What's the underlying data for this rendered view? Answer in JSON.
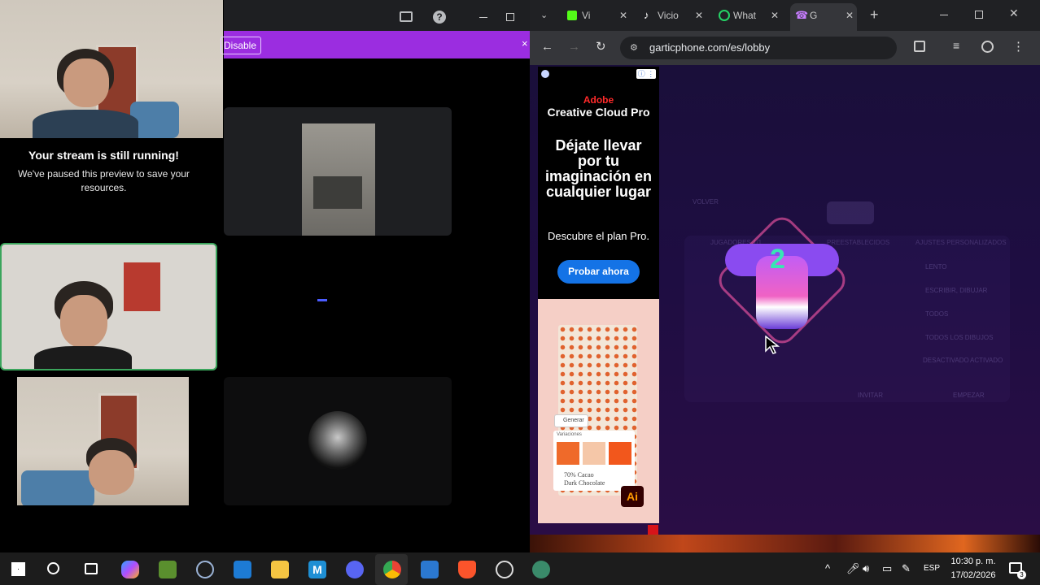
{
  "discord": {
    "stream_paused_title": "Your stream is still running!",
    "stream_paused_message": "We've paused this preview to save your resources.",
    "disable_label": "Disable"
  },
  "browser": {
    "tabs": [
      {
        "label": "Vi",
        "icon": "kick-icon"
      },
      {
        "label": "Vicio",
        "icon": "tiktok-icon"
      },
      {
        "label": "What",
        "icon": "whatsapp-icon"
      },
      {
        "label": "G",
        "icon": "garticphone-icon",
        "active": true
      }
    ],
    "url": "garticphone.com/es/lobby"
  },
  "ad": {
    "brand": "Adobe",
    "product": "Creative Cloud Pro",
    "headline": "Déjate llevar por tu imaginación en cualquier lugar",
    "subline": "Descubre el plan Pro.",
    "cta": "Probar ahora",
    "generar": "Generar",
    "variaciones": "Variaciones",
    "choc_line1": "70% Cacao",
    "choc_line2": "Dark Chocolate",
    "ai_badge": "Ai"
  },
  "lobby": {
    "back": "VOLVER",
    "players_header": "JUGADORES 1/1",
    "presets_header": "PREESTABLECIDOS",
    "custom_header": "AJUSTES PERSONALIZADOS",
    "settings": [
      {
        "value": "LENTO"
      },
      {
        "value": "ESCRIBIR, DIBUJAR"
      },
      {
        "value": "TODOS"
      },
      {
        "value": "TODOS LOS DIBUJOS"
      }
    ],
    "toggle_off": "DESACTIVADO",
    "toggle_on": "ACTIVADO",
    "invite": "INVITAR",
    "start": "EMPEZAR"
  },
  "taskbar": {
    "lang": "ESP",
    "time": "10:30 p. m.",
    "date": "17/02/2026",
    "notifications": "3"
  }
}
